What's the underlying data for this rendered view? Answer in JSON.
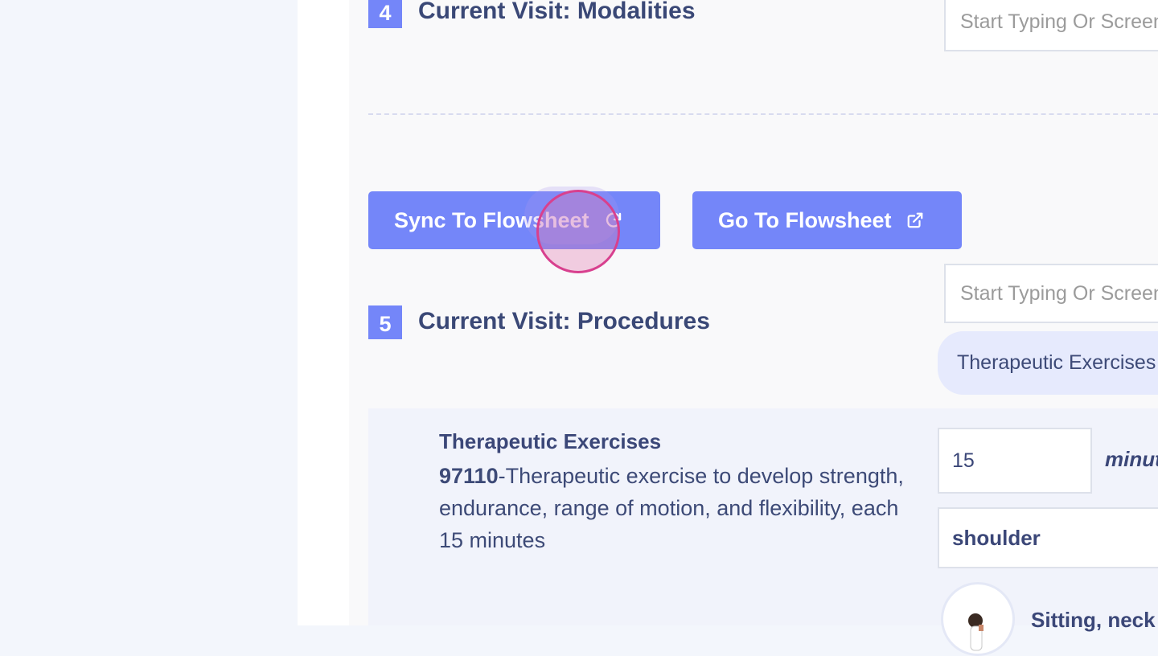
{
  "colors": {
    "accent": "#7486f9",
    "heading": "#3a4876",
    "page_bg": "#f3f6fc",
    "panel_bg": "#f9f9fa",
    "chip_bg": "#e6eafd",
    "click_indicator": "#d8408e"
  },
  "modalities": {
    "step_number": "4",
    "title": "Current Visit: Modalities",
    "search_placeholder": "Start Typing Or Screen"
  },
  "flowsheet": {
    "sync_label": "Sync To Flowsheet",
    "sync_icon": "refresh-icon",
    "go_label": "Go To Flowsheet",
    "go_icon": "external-link-icon"
  },
  "procedures": {
    "step_number": "5",
    "title": "Current Visit: Procedures",
    "search_placeholder": "Start Typing Or Screen",
    "selected_chip": "Therapeutic Exercises",
    "items": [
      {
        "name": "Therapeutic Exercises",
        "code": "97110",
        "description": "-Therapeutic exercise to develop strength, endurance, range of motion, and flexibility, each 15 minutes",
        "minutes_value": "15",
        "minutes_unit": "minutes",
        "body_part": "shoulder",
        "exercise_label": "Sitting, neck"
      }
    ]
  }
}
